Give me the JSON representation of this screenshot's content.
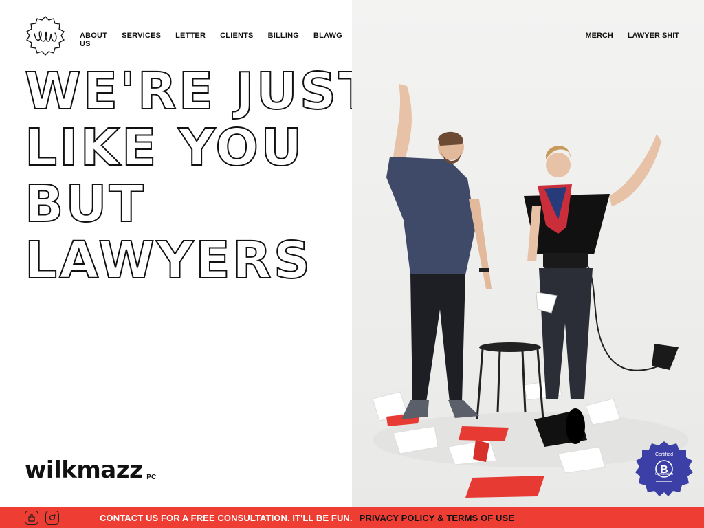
{
  "brand": {
    "logo_icon": "wm-monogram-badge-icon",
    "wordmark": "wilkmazz",
    "suffix": "PC"
  },
  "nav": {
    "left": [
      "ABOUT US",
      "SERVICES",
      "LETTER",
      "CLIENTS",
      "BILLING",
      "BLAWG"
    ],
    "right": [
      "MERCH",
      "LAWYER SHIT"
    ]
  },
  "hero": {
    "lines": [
      "WE'RE JUST",
      "LIKE YOU",
      "BUT",
      "LAWYERS"
    ]
  },
  "badge": {
    "icon": "b-corp-badge-icon",
    "top": "Certified",
    "bottom": "Corporation",
    "color": "#3b3fa6"
  },
  "footer": {
    "social_icons": [
      "facebook-icon",
      "instagram-icon"
    ],
    "cta": "CONTACT US FOR A FREE CONSULTATION. IT'LL BE FUN.",
    "privacy": "PRIVACY POLICY & TERMS OF USE",
    "bar_color": "#ee3d32"
  }
}
